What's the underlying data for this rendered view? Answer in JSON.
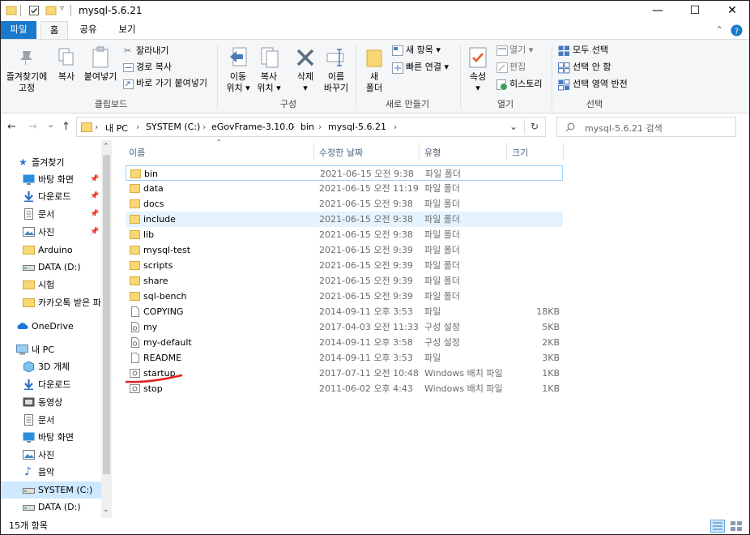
{
  "window": {
    "title": "mysql-5.6.21",
    "minimize": "—",
    "maximize": "☐",
    "close": "✕"
  },
  "ribbon_tabs": {
    "file": "파일",
    "home": "홈",
    "share": "공유",
    "view": "보기"
  },
  "ribbon": {
    "clipboard": {
      "pin_line1": "즐겨찾기에",
      "pin_line2": "고정",
      "copy": "복사",
      "paste": "붙여넣기",
      "cut": "잘라내기",
      "copy_path": "경로 복사",
      "paste_shortcut": "바로 가기 붙여넣기",
      "label": "클립보드"
    },
    "organize": {
      "move_line1": "이동",
      "move_line2": "위치 ▾",
      "copyto_line1": "복사",
      "copyto_line2": "위치 ▾",
      "delete_line1": "삭제",
      "delete_line2": "▾",
      "rename_line1": "이름",
      "rename_line2": "바꾸기",
      "label": "구성"
    },
    "new": {
      "folder_line1": "새",
      "folder_line2": "폴더",
      "new_item": "새 항목 ▾",
      "easy_access": "빠른 연결 ▾",
      "label": "새로 만들기"
    },
    "open": {
      "props": "속성",
      "props_arrow": "▾",
      "open": "열기 ▾",
      "edit": "편집",
      "history": "히스토리",
      "label": "열기"
    },
    "select": {
      "all": "모두 선택",
      "none": "선택 안 함",
      "invert": "선택 영역 반전",
      "label": "선택"
    }
  },
  "address": {
    "back": "←",
    "forward": "→",
    "recent": "⌄",
    "up": "↑",
    "crumbs": [
      "내 PC",
      "SYSTEM (C:)",
      "eGovFrame-3.10.0",
      "bin",
      "mysql-5.6.21"
    ],
    "separator": "›",
    "search_placeholder": "mysql-5.6.21 검색"
  },
  "nav": {
    "quick_access": "즐겨찾기",
    "items": [
      {
        "label": "바탕 화면",
        "icon": "desktop-icon"
      },
      {
        "label": "다운로드",
        "icon": "download-icon"
      },
      {
        "label": "문서",
        "icon": "documents-icon"
      },
      {
        "label": "사진",
        "icon": "pictures-icon"
      },
      {
        "label": "Arduino",
        "icon": "folder-icon"
      },
      {
        "label": "DATA (D:)",
        "icon": "drive-icon"
      },
      {
        "label": "시험",
        "icon": "folder-icon"
      },
      {
        "label": "카카오톡 받은 파",
        "icon": "folder-icon"
      }
    ],
    "onedrive": "OneDrive",
    "thispc": "내 PC",
    "pc_items": [
      {
        "label": "3D 개체",
        "icon": "3d-objects-icon"
      },
      {
        "label": "다운로드",
        "icon": "download-icon"
      },
      {
        "label": "동영상",
        "icon": "videos-icon"
      },
      {
        "label": "문서",
        "icon": "documents-icon"
      },
      {
        "label": "바탕 화면",
        "icon": "desktop-icon"
      },
      {
        "label": "사진",
        "icon": "pictures-icon"
      },
      {
        "label": "음악",
        "icon": "music-icon"
      },
      {
        "label": "SYSTEM (C:)",
        "icon": "drive-icon"
      },
      {
        "label": "DATA (D:)",
        "icon": "drive-icon"
      }
    ]
  },
  "columns": {
    "name": "이름",
    "date": "수정한 날짜",
    "type": "유형",
    "size": "크기"
  },
  "files": [
    {
      "name": "bin",
      "date": "2021-06-15 오전 9:38",
      "type": "파일 폴더",
      "size": "",
      "kind": "folder"
    },
    {
      "name": "data",
      "date": "2021-06-15 오전 11:19",
      "type": "파일 폴더",
      "size": "",
      "kind": "folder"
    },
    {
      "name": "docs",
      "date": "2021-06-15 오전 9:38",
      "type": "파일 폴더",
      "size": "",
      "kind": "folder"
    },
    {
      "name": "include",
      "date": "2021-06-15 오전 9:38",
      "type": "파일 폴더",
      "size": "",
      "kind": "folder"
    },
    {
      "name": "lib",
      "date": "2021-06-15 오전 9:38",
      "type": "파일 폴더",
      "size": "",
      "kind": "folder"
    },
    {
      "name": "mysql-test",
      "date": "2021-06-15 오전 9:39",
      "type": "파일 폴더",
      "size": "",
      "kind": "folder"
    },
    {
      "name": "scripts",
      "date": "2021-06-15 오전 9:39",
      "type": "파일 폴더",
      "size": "",
      "kind": "folder"
    },
    {
      "name": "share",
      "date": "2021-06-15 오전 9:39",
      "type": "파일 폴더",
      "size": "",
      "kind": "folder"
    },
    {
      "name": "sql-bench",
      "date": "2021-06-15 오전 9:39",
      "type": "파일 폴더",
      "size": "",
      "kind": "folder"
    },
    {
      "name": "COPYING",
      "date": "2014-09-11 오후 3:53",
      "type": "파일",
      "size": "18KB",
      "kind": "file"
    },
    {
      "name": "my",
      "date": "2017-04-03 오전 11:33",
      "type": "구성 설정",
      "size": "5KB",
      "kind": "config"
    },
    {
      "name": "my-default",
      "date": "2014-09-11 오후 3:58",
      "type": "구성 설정",
      "size": "2KB",
      "kind": "config"
    },
    {
      "name": "README",
      "date": "2014-09-11 오후 3:53",
      "type": "파일",
      "size": "3KB",
      "kind": "file"
    },
    {
      "name": "startup",
      "date": "2017-07-11 오전 10:48",
      "type": "Windows 배치 파일",
      "size": "1KB",
      "kind": "batch"
    },
    {
      "name": "stop",
      "date": "2011-06-02 오후 4:43",
      "type": "Windows 배치 파일",
      "size": "1KB",
      "kind": "batch"
    }
  ],
  "status": {
    "count": "15개 항목"
  },
  "colors": {
    "accent": "#1979ca",
    "folder": "#f8d775",
    "selection": "#cde8ff",
    "hover": "#e5f3ff",
    "annotation": "#e02020"
  }
}
